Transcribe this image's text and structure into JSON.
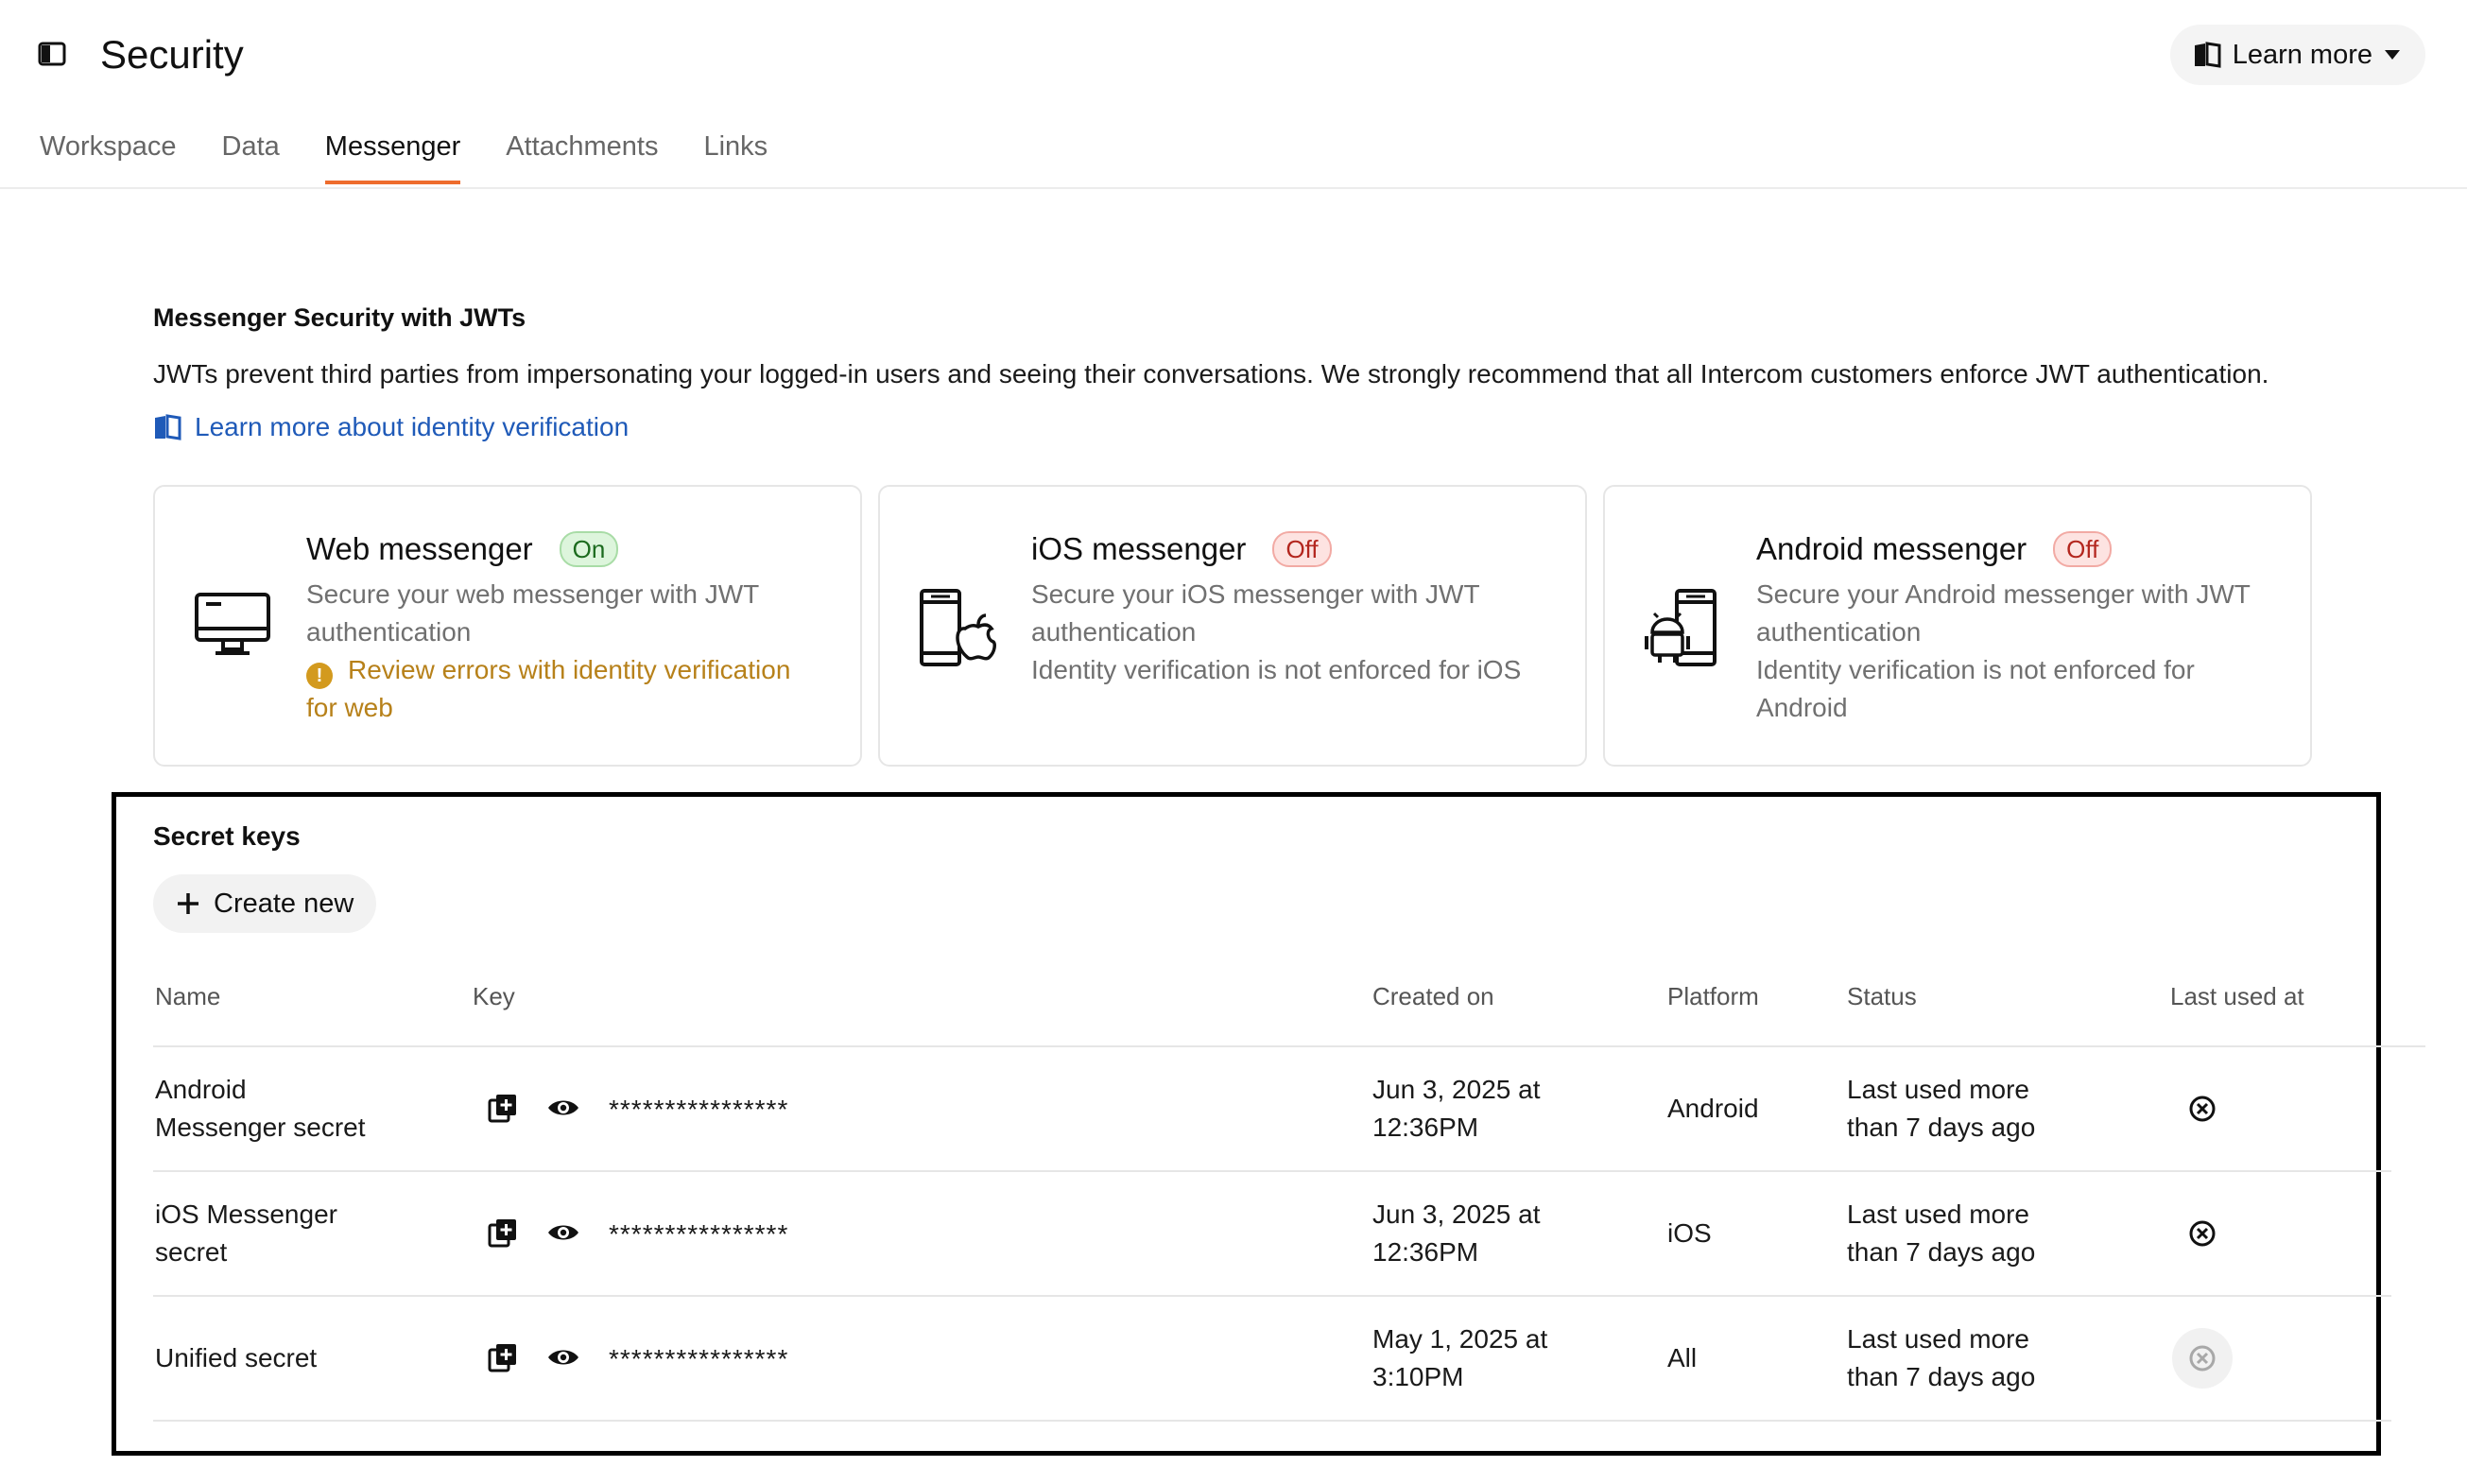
{
  "header": {
    "title": "Security",
    "learn_more": "Learn more",
    "tabs": [
      {
        "label": "Workspace"
      },
      {
        "label": "Data"
      },
      {
        "label": "Messenger"
      },
      {
        "label": "Attachments"
      },
      {
        "label": "Links"
      }
    ],
    "active_tab": "Messenger"
  },
  "intro": {
    "title": "Messenger Security with JWTs",
    "description": "JWTs prevent third parties from impersonating your logged-in users and seeing their conversations. We strongly recommend that all Intercom customers enforce JWT authentication.",
    "link": "Learn more about identity verification"
  },
  "cards": [
    {
      "title": "Web messenger",
      "status": "On",
      "description": "Secure your web messenger with JWT authentication",
      "warning": "Review errors with identity verification for web",
      "icon": "desktop-icon"
    },
    {
      "title": "iOS messenger",
      "status": "Off",
      "description": "Secure your iOS messenger with JWT authentication",
      "note": "Identity verification is not enforced for iOS",
      "icon": "ios-phone-icon"
    },
    {
      "title": "Android messenger",
      "status": "Off",
      "description": "Secure your Android messenger with JWT authentication",
      "note": "Identity verification is not enforced for Android",
      "icon": "android-phone-icon"
    }
  ],
  "secret_keys": {
    "title": "Secret keys",
    "create_label": "Create new",
    "columns": {
      "name": "Name",
      "key": "Key",
      "created": "Created on",
      "platform": "Platform",
      "status": "Status",
      "last_used": "Last used at"
    },
    "rows": [
      {
        "name_line1": "Android",
        "name_line2": "Messenger secret",
        "key": "****************",
        "created_line1": "Jun 3, 2025 at",
        "created_line2": "12:36PM",
        "platform": "Android",
        "status_line1": "Last used more",
        "status_line2": "than 7 days ago"
      },
      {
        "name_line1": "iOS Messenger",
        "name_line2": "secret",
        "key": "****************",
        "created_line1": "Jun 3, 2025 at",
        "created_line2": "12:36PM",
        "platform": "iOS",
        "status_line1": "Last used more",
        "status_line2": "than 7 days ago"
      },
      {
        "name_line1": "Unified secret",
        "name_line2": "",
        "key": "****************",
        "created_line1": "May 1, 2025 at",
        "created_line2": "3:10PM",
        "platform": "All",
        "status_line1": "Last used more",
        "status_line2": "than 7 days ago"
      }
    ]
  },
  "colors": {
    "tab_underline": "#ee6c2d",
    "link": "#1f5ab8",
    "warning": "#b7811a",
    "badge_on": "#ddf5dc",
    "badge_off": "#fde3e1"
  }
}
